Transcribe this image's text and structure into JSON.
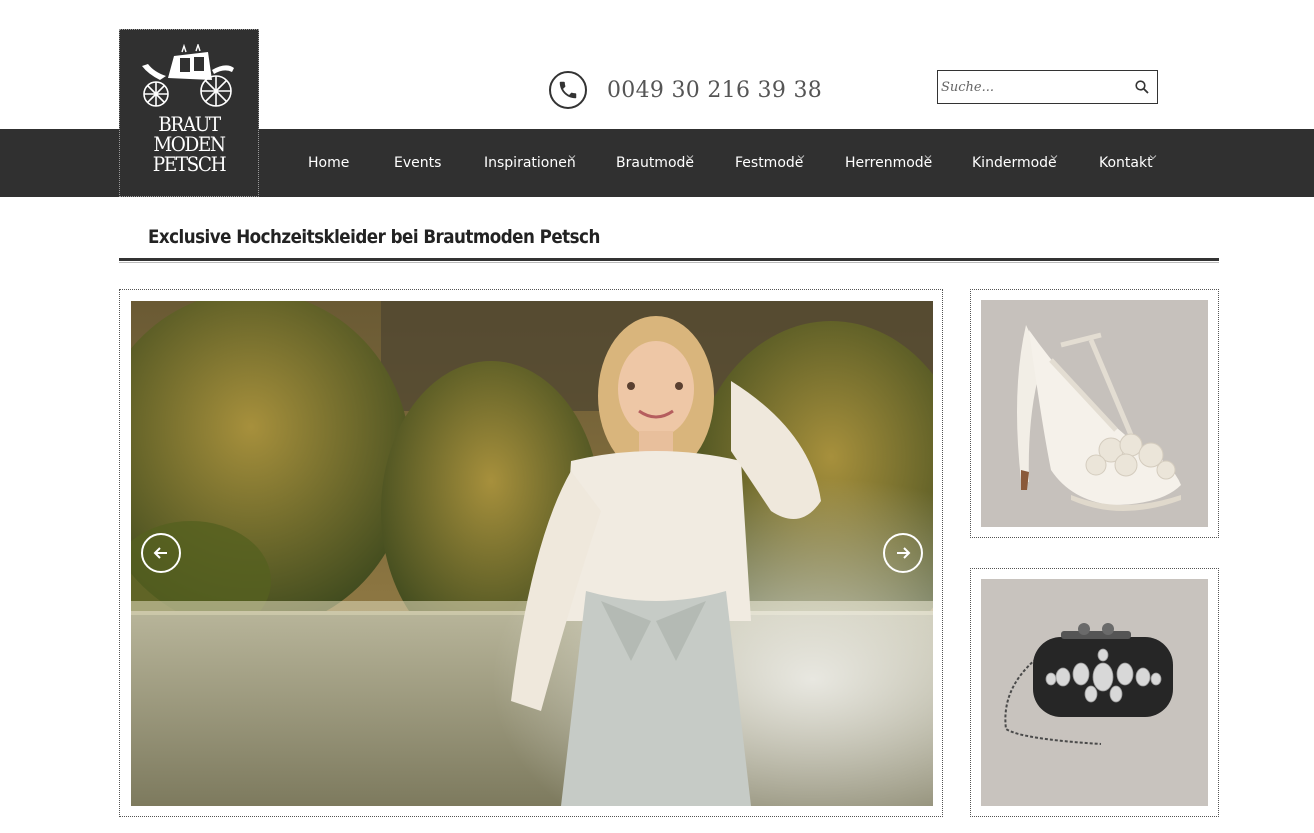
{
  "logo": {
    "lines": [
      "BRAUT",
      "MODEN",
      "PETSCH"
    ]
  },
  "contact": {
    "phone": "0049 30 216 39 38"
  },
  "search": {
    "placeholder": "Suche..."
  },
  "menu": {
    "items": [
      {
        "label": "Home",
        "dropdown": false
      },
      {
        "label": "Events",
        "dropdown": false
      },
      {
        "label": "Inspirationen",
        "dropdown": true
      },
      {
        "label": "Brautmode",
        "dropdown": true
      },
      {
        "label": "Festmode",
        "dropdown": true
      },
      {
        "label": "Herrenmode",
        "dropdown": true
      },
      {
        "label": "Kindermode",
        "dropdown": true
      },
      {
        "label": "Kontakt",
        "dropdown": true
      }
    ]
  },
  "page": {
    "title": "Exclusive Hochzeitskleider bei Brautmoden Petsch"
  },
  "colors": {
    "nav_bg": "#303030",
    "text_dark": "#222222"
  }
}
